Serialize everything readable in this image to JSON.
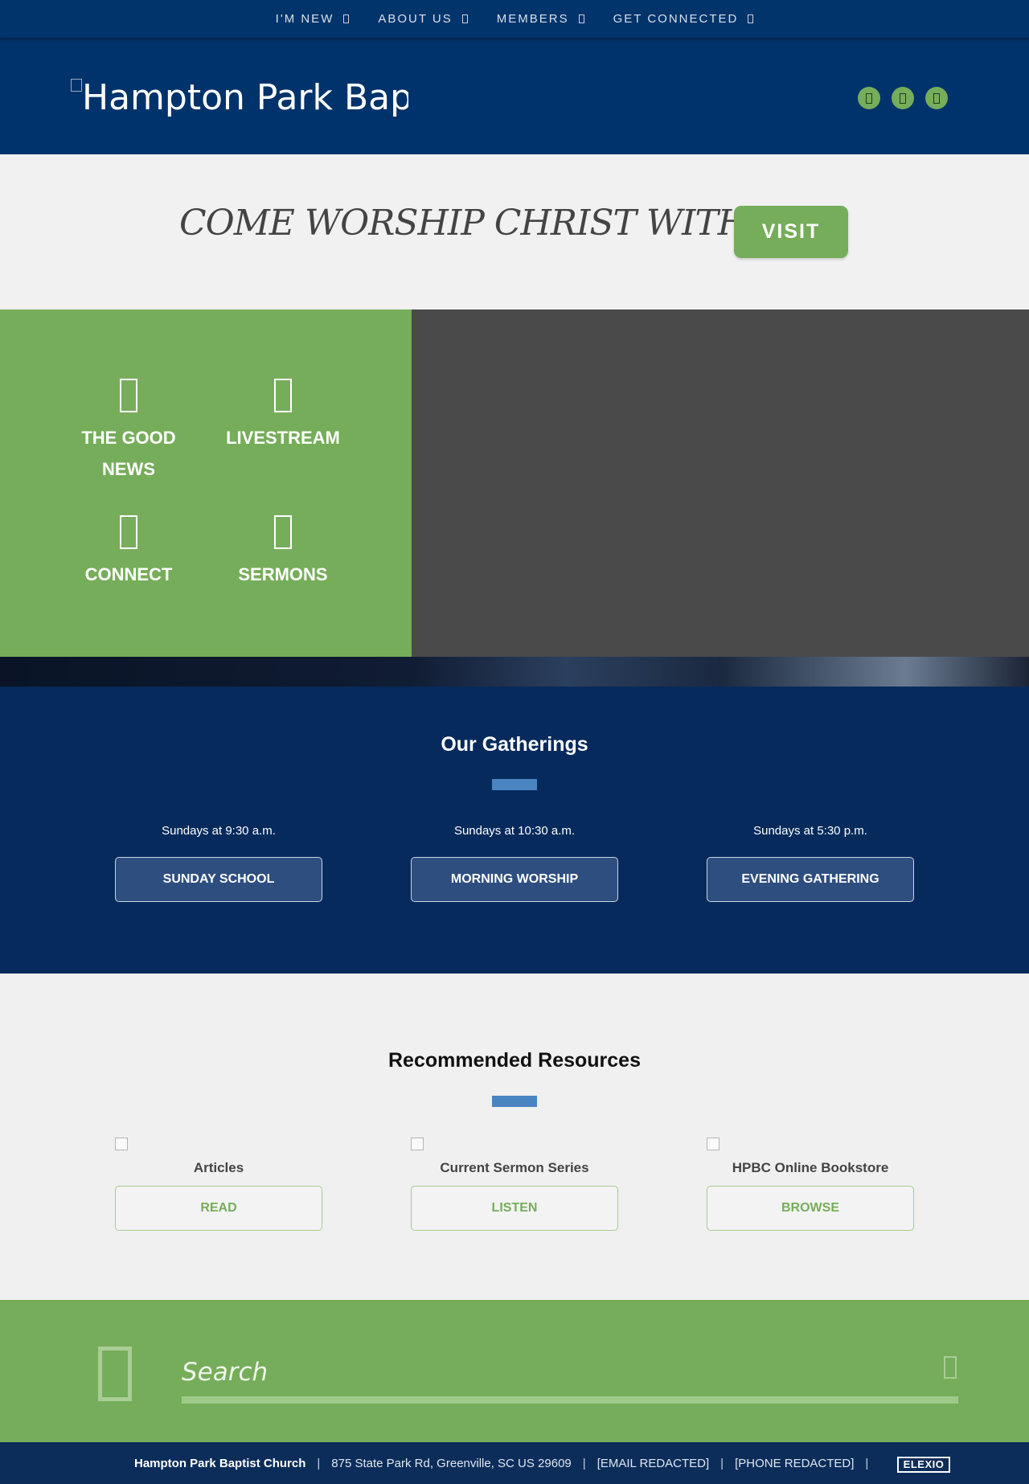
{
  "nav": {
    "items": [
      "I'M NEW",
      "ABOUT US",
      "MEMBERS",
      "GET CONNECTED"
    ]
  },
  "header": {
    "logo_alt": "Hampton Park Baptist Church",
    "social_icons": [
      "facebook-icon",
      "youtube-icon",
      "instagram-icon"
    ]
  },
  "cta": {
    "text": "COME WORSHIP CHRIST WITH US",
    "button": "VISIT"
  },
  "quick_links": [
    {
      "label": "THE GOOD NEWS",
      "icon": "book-icon"
    },
    {
      "label": "LIVESTREAM",
      "icon": "video-icon"
    },
    {
      "label": "CONNECT",
      "icon": "users-icon"
    },
    {
      "label": "SERMONS",
      "icon": "microphone-icon"
    }
  ],
  "gatherings": {
    "title": "Our Gatherings",
    "items": [
      {
        "time": "Sundays at 9:30 a.m.",
        "button": "SUNDAY SCHOOL"
      },
      {
        "time": "Sundays at 10:30 a.m.",
        "button": "MORNING WORSHIP"
      },
      {
        "time": "Sundays at 5:30 p.m.",
        "button": "EVENING GATHERING"
      }
    ]
  },
  "resources": {
    "title": "Recommended Resources",
    "items": [
      {
        "title": "Articles",
        "button": "READ"
      },
      {
        "title": "Current Sermon Series",
        "button": "LISTEN"
      },
      {
        "title": "HPBC Online Bookstore",
        "button": "BROWSE"
      }
    ]
  },
  "search": {
    "placeholder": "Search"
  },
  "footer": {
    "church_name": "Hampton Park Baptist Church",
    "address": "875 State Park Rd, Greenville, SC US 29609",
    "email": "[EMAIL REDACTED]",
    "phone": "[PHONE REDACTED]",
    "separator": "|",
    "badge": "ELEXIO"
  },
  "colors": {
    "navy": "#00346b",
    "green": "#76ad5a",
    "accent_blue": "#4a84c1",
    "gatherings_bg": "#062a5c"
  }
}
